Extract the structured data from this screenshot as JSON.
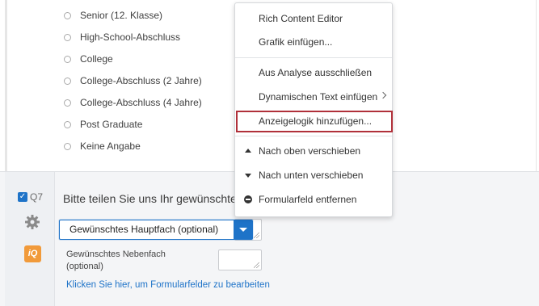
{
  "choices": [
    "Senior (12. Klasse)",
    "High-School-Abschluss",
    "College",
    "College-Abschluss (2 Jahre)",
    "College-Abschluss (4 Jahre)",
    "Post Graduate",
    "Keine Angabe"
  ],
  "question": {
    "number": "Q7",
    "text": "Bitte teilen Sie uns Ihr gewünschtes",
    "select_value": "Gewünschtes Hauptfach (optional)",
    "field_label": "Gewünschtes Nebenfach (optional)",
    "edit_link": "Klicken Sie hier, um Formularfelder zu bearbeiten",
    "iq_label": "iQ"
  },
  "menu": {
    "rich_content_editor": "Rich Content Editor",
    "insert_graphic": "Grafik einfügen...",
    "exclude_from_analysis": "Aus Analyse ausschließen",
    "piped_text": "Dynamischen Text einfügen",
    "add_display_logic": "Anzeigelogik hinzufügen...",
    "move_up": "Nach oben verschieben",
    "move_down": "Nach unten verschieben",
    "remove_field": "Formularfeld entfernen"
  },
  "colors": {
    "accent": "#1e73c8",
    "highlight": "#b0303a",
    "iq_badge": "#f19a3a"
  }
}
